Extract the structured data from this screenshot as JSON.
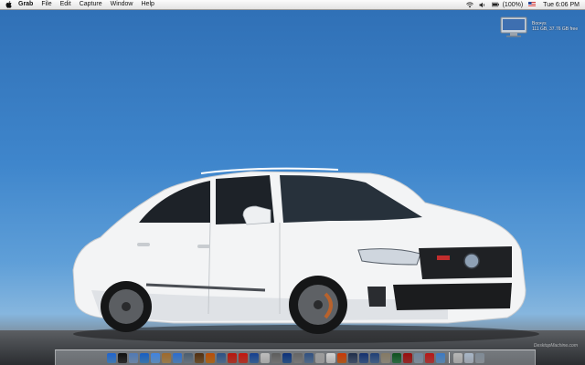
{
  "menubar": {
    "apple_icon": "apple-icon",
    "app_name": "Grab",
    "menus": [
      "File",
      "Edit",
      "Capture",
      "Window",
      "Help"
    ],
    "status_icons": [
      "wifi-icon",
      "volume-icon",
      "battery-icon"
    ],
    "battery_text": "(100%)",
    "clock": "Tue 6:06 PM"
  },
  "desktop": {
    "drive_icon": "hard-drive-icon",
    "drive_label_line1": "Boo•ys",
    "drive_label_line2": "111 GB, 37.76 GB free"
  },
  "wallpaper": {
    "subject": "white sedan",
    "watermark": "DesktopMachine.com",
    "colors": {
      "sky": "#3f86cc",
      "car_body": "#f4f5f6",
      "ground": "#3e4145"
    }
  },
  "dock": {
    "left_icons": [
      {
        "name": "finder-icon",
        "color": "#5aa0e6"
      },
      {
        "name": "dashboard-icon",
        "color": "#3d3d3d"
      },
      {
        "name": "mail-icon",
        "color": "#8fb0d8"
      },
      {
        "name": "safari-icon",
        "color": "#4e9be0"
      },
      {
        "name": "ichat-icon",
        "color": "#7fb7f0"
      },
      {
        "name": "address-book-icon",
        "color": "#c9a46a"
      },
      {
        "name": "itunes-icon",
        "color": "#6aa6e6"
      },
      {
        "name": "iphoto-icon",
        "color": "#8a9aa8"
      },
      {
        "name": "imovie-icon",
        "color": "#8f6b3e"
      },
      {
        "name": "garageband-icon",
        "color": "#d98b2c"
      },
      {
        "name": "idvd-icon",
        "color": "#6a8fb8"
      },
      {
        "name": "preview-icon",
        "color": "#d94a3a"
      },
      {
        "name": "ical-icon",
        "color": "#e04a3a"
      },
      {
        "name": "network-icon",
        "color": "#4a7fc0"
      },
      {
        "name": "terminal-icon",
        "color": "#dcdcdc"
      },
      {
        "name": "system-preferences-icon",
        "color": "#9a9a9a"
      },
      {
        "name": "xcode-icon",
        "color": "#3a6fb0"
      },
      {
        "name": "utility-icon",
        "color": "#a0a0a0"
      },
      {
        "name": "monitor-icon",
        "color": "#6f8fb5"
      },
      {
        "name": "editor-icon",
        "color": "#c8c8c8"
      },
      {
        "name": "text-edit-icon",
        "color": "#e8e8e8"
      },
      {
        "name": "firefox-icon",
        "color": "#e2772a"
      },
      {
        "name": "camino-icon",
        "color": "#5a6c8a"
      },
      {
        "name": "quicktime-icon",
        "color": "#4a6fa8"
      },
      {
        "name": "photoshop-icon",
        "color": "#5b7fae"
      },
      {
        "name": "illustrator-icon",
        "color": "#b8b0a0"
      },
      {
        "name": "dreamweaver-icon",
        "color": "#3d8f5a"
      },
      {
        "name": "flash-icon",
        "color": "#c43a3a"
      },
      {
        "name": "fireworks-icon",
        "color": "#a8b8c8"
      },
      {
        "name": "acrobat-icon",
        "color": "#d84c4c"
      },
      {
        "name": "grab-icon",
        "color": "#7bb0e0"
      }
    ],
    "right_icons": [
      {
        "name": "downloads-stack-icon",
        "color": "#d8d8d8"
      },
      {
        "name": "documents-stack-icon",
        "color": "#cfd8e2"
      },
      {
        "name": "trash-icon",
        "color": "#b4bcc4"
      }
    ]
  }
}
